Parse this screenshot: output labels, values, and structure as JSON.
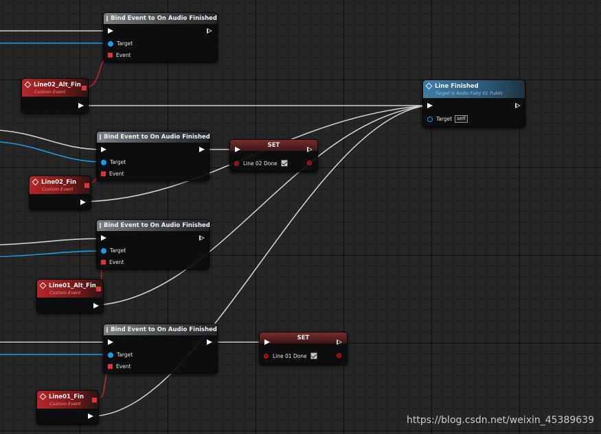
{
  "bind_nodes": [
    {
      "title": "Bind Event to On Audio Finished",
      "target_label": "Target",
      "event_label": "Event"
    },
    {
      "title": "Bind Event to On Audio Finished",
      "target_label": "Target",
      "event_label": "Event"
    },
    {
      "title": "Bind Event to On Audio Finished",
      "target_label": "Target",
      "event_label": "Event"
    },
    {
      "title": "Bind Event to On Audio Finished",
      "target_label": "Target",
      "event_label": "Event"
    }
  ],
  "event_nodes": [
    {
      "title": "Line02_Alt_Fin",
      "subtitle": "Custom Event"
    },
    {
      "title": "Line02_Fin",
      "subtitle": "Custom Event"
    },
    {
      "title": "Line01_Alt_Fin",
      "subtitle": "Custom Event"
    },
    {
      "title": "Line01_Fin",
      "subtitle": "Custom Event"
    }
  ],
  "set_nodes": [
    {
      "title": "SET",
      "var_label": "Line 02 Done",
      "checked": true
    },
    {
      "title": "SET",
      "var_label": "Line 01 Done",
      "checked": true
    }
  ],
  "call_node": {
    "title": "Line Finished",
    "subtitle": "Target is Audio Fairy 01 Public",
    "target_label": "Target",
    "target_value": "self"
  },
  "colors": {
    "exec_wire": "#cfcfcf",
    "object_wire": "#1c9be6",
    "delegate_wire": "#d42a2a",
    "event_header": "#b5282a",
    "call_header": "#3f7da6"
  },
  "watermark": "https://blog.csdn.net/weixin_45389639"
}
